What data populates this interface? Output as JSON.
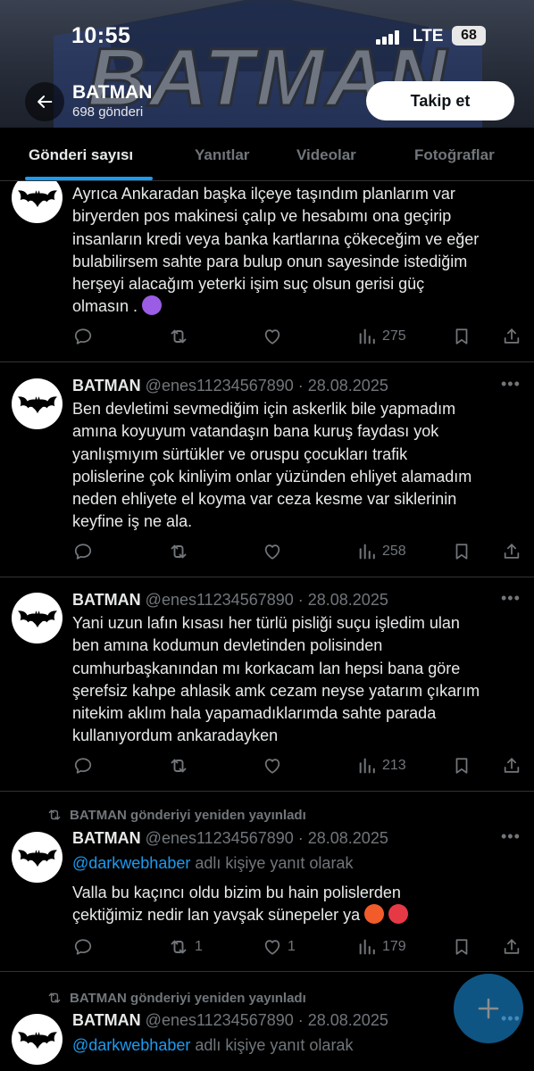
{
  "status_bar": {
    "time": "10:55",
    "network": "LTE",
    "battery": "68"
  },
  "header": {
    "banner_text": "BATMAN",
    "profile_name": "BATMAN",
    "post_count": "698 gönderi",
    "follow_label": "Takip et"
  },
  "tabs": [
    {
      "label": "Gönderi sayısı",
      "active": true
    },
    {
      "label": "Yanıtlar",
      "active": false
    },
    {
      "label": "Videolar",
      "active": false
    },
    {
      "label": "Fotoğraflar",
      "active": false
    }
  ],
  "posts": [
    {
      "text_lines": [
        "Ayrıca Ankaradan başka ilçeye taşındım planlarım var",
        "biryerden pos makinesi çalıp ve hesabımı ona geçirip",
        "insanların kredi veya banka kartlarına çökeceğim ve eğer",
        "bulabilirsem sahte para bulup onun sayesinde istediğim",
        "herşeyi alacağım yeterki işim suç olsun gerisi güç",
        "olmasın ."
      ],
      "views": "275"
    },
    {
      "name": "BATMAN",
      "meta": "@enes11234567890 · 28.08.2025",
      "text_lines": [
        "Ben devletimi sevmediğim için askerlik bile yapmadım",
        "amına koyuyum vatandaşın bana kuruş faydası yok",
        "yanlışmıyım sürtükler ve oruspu çocukları  trafik",
        "polislerine çok kinliyim onlar yüzünden ehliyet alamadım",
        "neden ehliyete el koyma var ceza kesme var siklerinin",
        "keyfine iş ne ala."
      ],
      "views": "258"
    },
    {
      "name": "BATMAN",
      "meta": "@enes11234567890 · 28.08.2025",
      "text_lines": [
        "Yani uzun lafın kısası her türlü pisliği suçu işledim ulan",
        "ben amına kodumun devletinden polisinden",
        "cumhurbaşkanından mı korkacam lan hepsi bana göre",
        "şerefsiz kahpe ahlasik amk cezam neyse yatarım çıkarım",
        "nitekim aklım hala yapamadıklarımda sahte parada",
        "kullanıyordum ankaradayken"
      ],
      "views": "213"
    },
    {
      "repost_note": "BATMAN gönderiyi yeniden yayınladı",
      "name": "BATMAN",
      "meta": "@enes11234567890 · 28.08.2025",
      "reply_mention": "@darkwebhaber",
      "reply_suffix": " adlı kişiye yanıt olarak",
      "text_lines": [
        "Valla bu kaçıncı oldu bizim bu hain polislerden",
        "çektiğimiz nedir lan yavşak sünepeler ya"
      ],
      "reposts": "1",
      "likes": "1",
      "views": "179"
    },
    {
      "repost_note": "BATMAN gönderiyi yeniden yayınladı",
      "name": "BATMAN",
      "meta": "@enes11234567890 · 28.08.2025",
      "reply_mention": "@darkwebhaber",
      "reply_suffix": " adlı kişiye yanıt olarak"
    }
  ],
  "icons": {
    "back": "arrow-left-icon",
    "reply": "comment-icon",
    "repost": "repost-icon",
    "like": "heart-icon",
    "views": "views-icon",
    "bookmark": "bookmark-icon",
    "share": "share-icon",
    "compose": "plus-icon"
  },
  "colors": {
    "accent": "#1d9bf0",
    "muted": "#71767b",
    "text": "#e7e9ea",
    "background": "#000000"
  }
}
